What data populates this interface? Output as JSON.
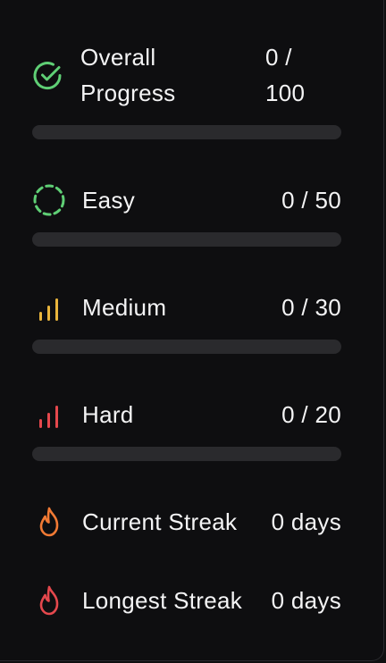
{
  "stats": {
    "overall": {
      "label": "Overall Progress",
      "value": "0 / 100",
      "progress": 0,
      "color": "#5fcf75"
    },
    "easy": {
      "label": "Easy",
      "value": "0 / 50",
      "progress": 0,
      "color": "#5fcf75"
    },
    "medium": {
      "label": "Medium",
      "value": "0 / 30",
      "progress": 0,
      "color": "#e9b53c"
    },
    "hard": {
      "label": "Hard",
      "value": "0 / 20",
      "progress": 0,
      "color": "#e5484d"
    },
    "current_streak": {
      "label": "Current Streak",
      "value": "0 days",
      "color": "#f27a34"
    },
    "longest_streak": {
      "label": "Longest Streak",
      "value": "0 days",
      "color": "#e5484d"
    }
  },
  "icons": {
    "overall": "check-circle-icon",
    "easy": "dashed-circle-icon",
    "medium": "signal-bars-icon",
    "hard": "signal-bars-icon",
    "current_streak": "flame-icon",
    "longest_streak": "flame-icon"
  }
}
